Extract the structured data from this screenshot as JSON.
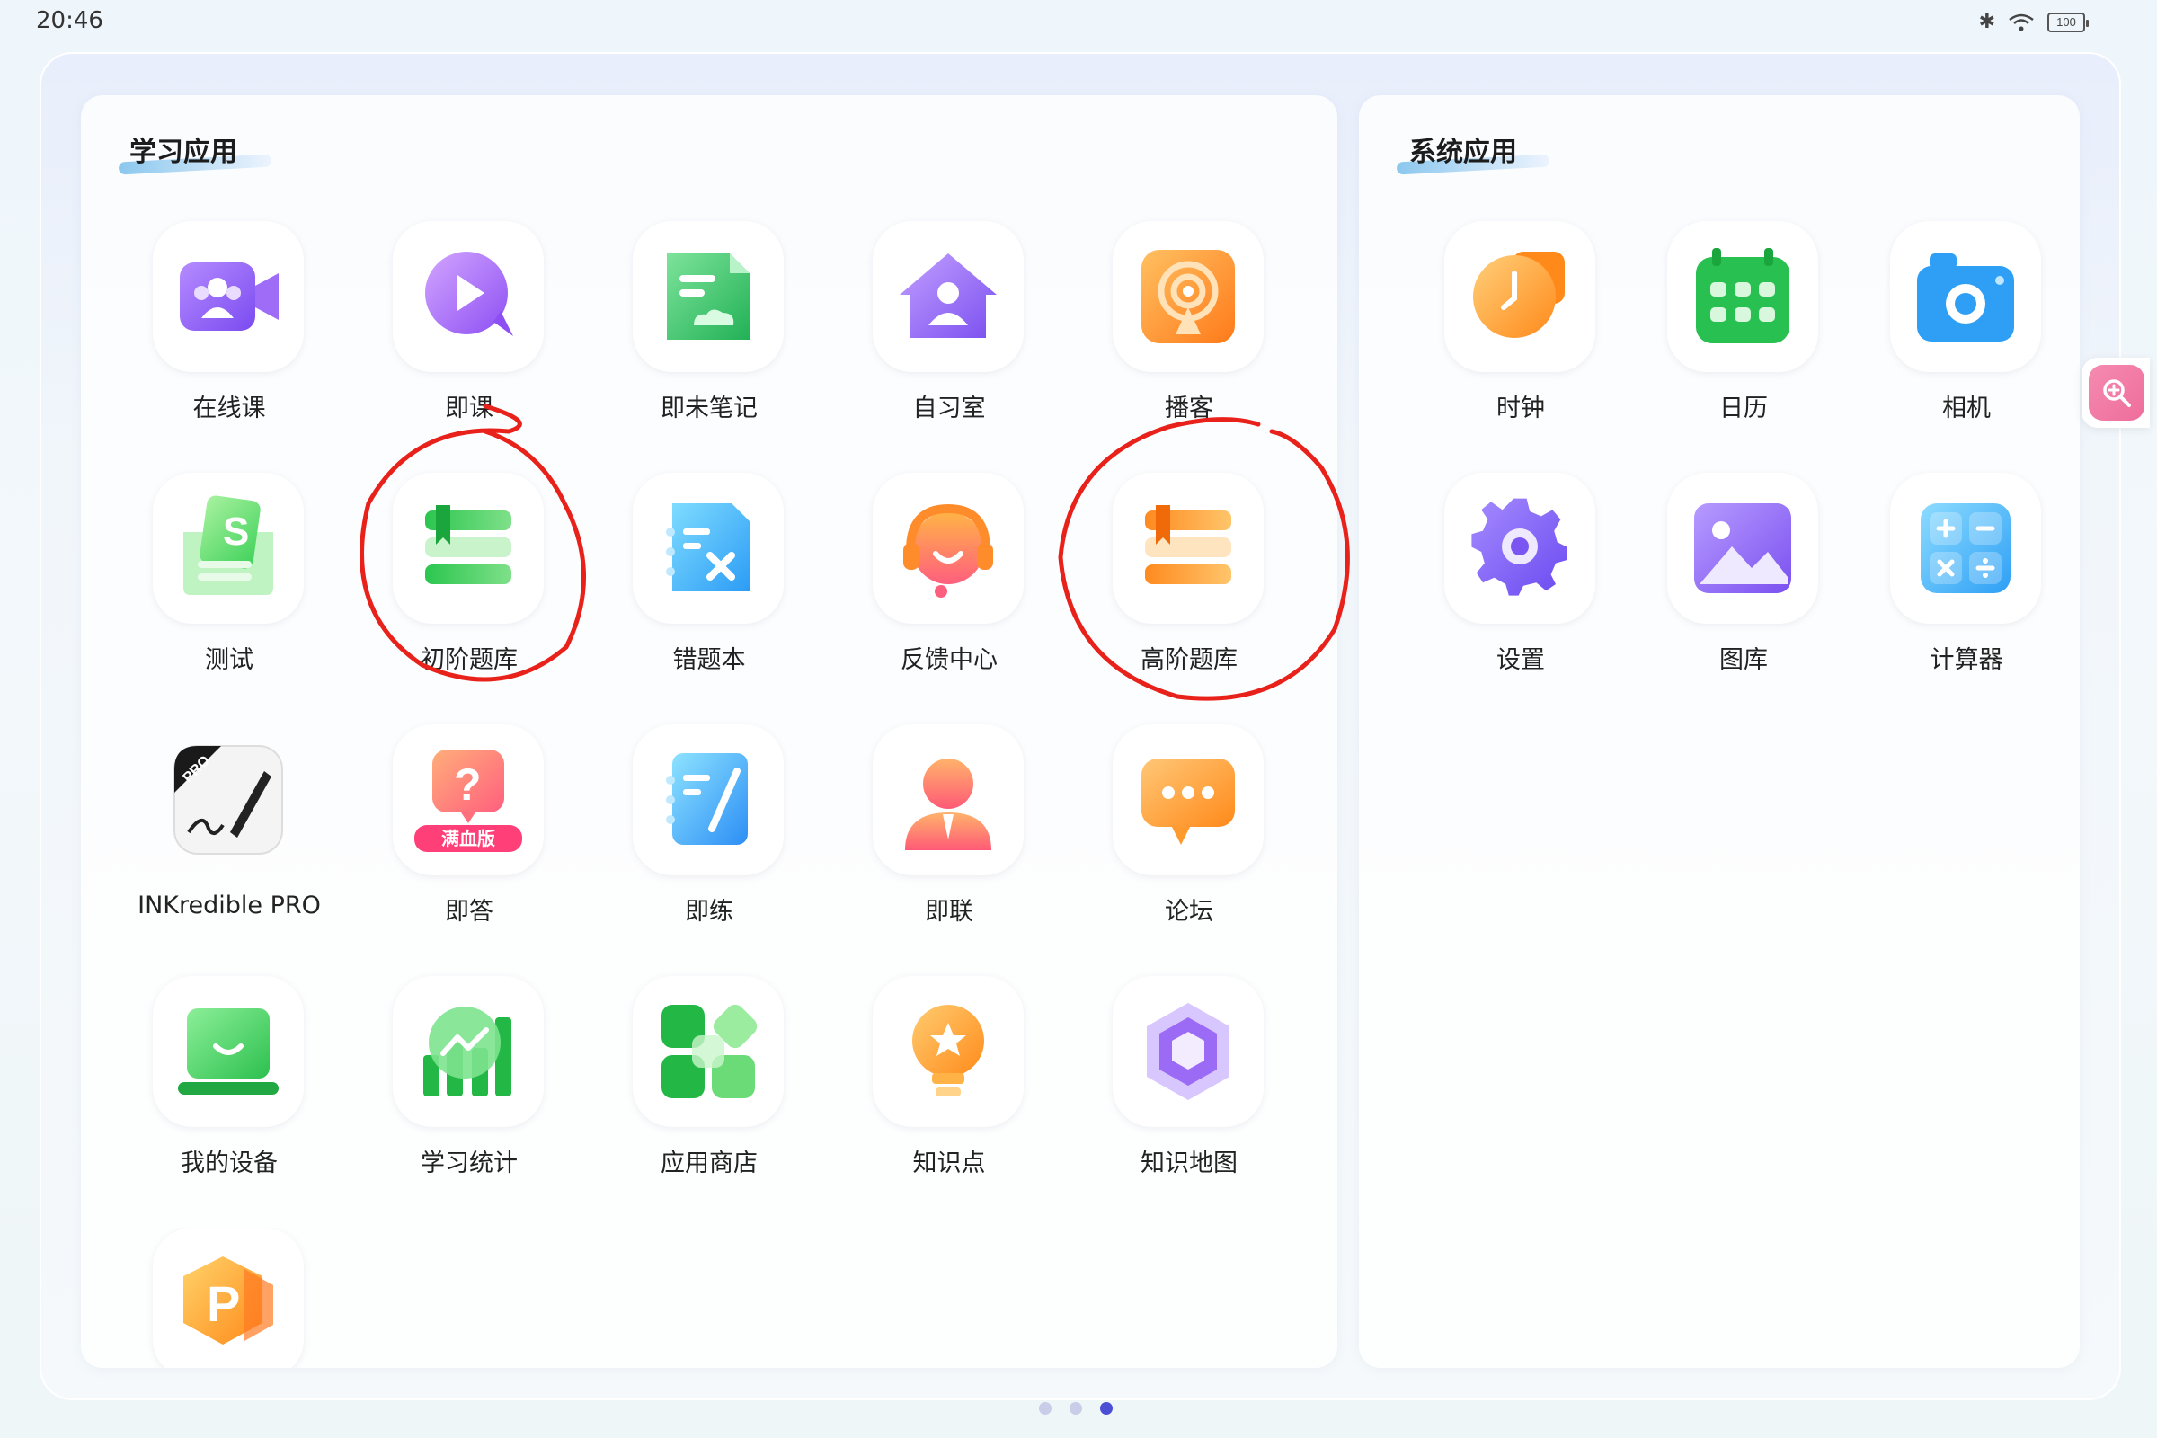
{
  "status_bar": {
    "time": "20:46",
    "battery": "100",
    "icons": [
      "bluetooth-icon",
      "wifi-icon",
      "battery-icon"
    ]
  },
  "study_section": {
    "title": "学习应用",
    "apps": [
      {
        "label": "在线课",
        "icon": "video-group-icon"
      },
      {
        "label": "即课",
        "icon": "play-bubble-icon"
      },
      {
        "label": "即未笔记",
        "icon": "note-icon"
      },
      {
        "label": "自习室",
        "icon": "study-room-icon"
      },
      {
        "label": "播客",
        "icon": "podcast-icon"
      },
      {
        "label": "测试",
        "icon": "test-icon"
      },
      {
        "label": "初阶题库",
        "icon": "green-books-icon"
      },
      {
        "label": "错题本",
        "icon": "wrong-notebook-icon"
      },
      {
        "label": "反馈中心",
        "icon": "headset-icon"
      },
      {
        "label": "高阶题库",
        "icon": "orange-books-icon"
      },
      {
        "label": "INKredible PRO",
        "icon": "pen-icon",
        "badge": "PRO"
      },
      {
        "label": "即答",
        "icon": "question-bubble-icon",
        "badge": "满血版"
      },
      {
        "label": "即练",
        "icon": "practice-notebook-icon"
      },
      {
        "label": "即联",
        "icon": "person-icon"
      },
      {
        "label": "论坛",
        "icon": "chat-bubble-icon"
      },
      {
        "label": "我的设备",
        "icon": "device-icon"
      },
      {
        "label": "学习统计",
        "icon": "stats-icon"
      },
      {
        "label": "应用商店",
        "icon": "app-store-icon"
      },
      {
        "label": "知识点",
        "icon": "lightbulb-star-icon"
      },
      {
        "label": "知识地图",
        "icon": "hexagon-cube-icon"
      },
      {
        "label": "",
        "icon": "p-hexagon-icon"
      }
    ]
  },
  "system_section": {
    "title": "系统应用",
    "apps": [
      {
        "label": "时钟",
        "icon": "clock-icon"
      },
      {
        "label": "日历",
        "icon": "calendar-icon"
      },
      {
        "label": "相机",
        "icon": "camera-icon"
      },
      {
        "label": "设置",
        "icon": "gear-icon"
      },
      {
        "label": "图库",
        "icon": "gallery-icon"
      },
      {
        "label": "计算器",
        "icon": "calculator-icon"
      }
    ]
  },
  "side_button": {
    "icon": "zoom-in-icon"
  },
  "pagination": {
    "pages": 3,
    "current": 3
  },
  "annotations": {
    "circled_apps": [
      "初阶题库",
      "高阶题库"
    ],
    "color": "#e8211a"
  }
}
